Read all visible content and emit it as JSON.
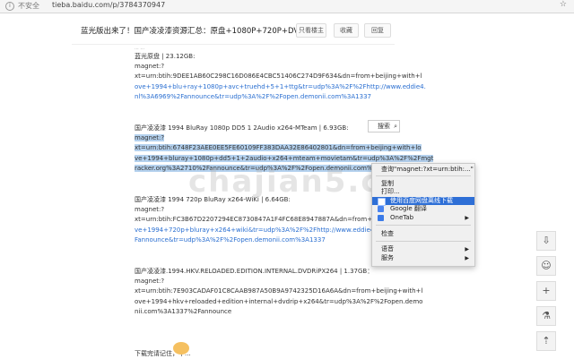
{
  "address": {
    "secure_label": "不安全",
    "url": "tieba.baidu.com/p/3784370947"
  },
  "header": {
    "title": "蓝光版出来了！国产凌凌漆资源汇总：原盘+1080P+720P+DVD...",
    "btn_owner": "只看楼主",
    "btn_fav": "收藏",
    "btn_reply": "回复"
  },
  "post": {
    "lines_a": [
      "蓝光原盘 | 23.12GB:",
      "magnet:?",
      "xt=urn:btih:9DEE1AB60C298C16D086E4CBC51406C274D9F634&dn=from+beijing+with+l",
      "ove+1994+blu+ray+1080p+avc+truehd+5+1+ttg&tr=udp%3A%2F%2Fhttp://www.eddie4.",
      "nl%3A6969%2Fannounce&tr=udp%3A%2F%2Fopen.demonii.com%3A1337"
    ],
    "lines_b_title": "国产凌凌漆 1994 BluRay 1080p DD5 1 2Audio x264-MTeam | 6.93GB:",
    "lines_b": [
      "magnet:?",
      "xt=urn:btih:6748F23AEE0EE5FE60109FF383DAA32E86402801&dn=from+beijing+with+lo",
      "ve+1994+bluray+1080p+dd5+1+2audio+x264+mteam+movietam&tr=udp%3A%2F%2Fmgt",
      "racker.org%3A2710%2Fannounce&tr=udp%3A%2F%2Fopen.demonii.com%3A1337"
    ],
    "lines_c_title": "国产凌凌漆 1994 720p BluRay x264-WiKi | 6.64GB:",
    "lines_c": [
      "magnet:?",
      "xt=urn:btih:FC3B67D2207294EC8730847A1F4FC68E8947887A&dn=from+beijing+with+lo",
      "ve+1994+720p+bluray+x264+wiki&tr=udp%3A%2F%2Fhttp://www.eddie4.nl%3A6969%2F",
      "Fannounce&tr=udp%3A%2F%2Fopen.demonii.com%3A1337"
    ],
    "lines_d_title": "国产凌凌漆.1994.HKV.RELOADED.EDITION.INTERNAL.DVDRiPX264 | 1.37GB：",
    "lines_d": [
      "magnet:?",
      "xt=urn:btih:7E903CADAF01C8CAAB987A50B9A9742325D16A6A&dn=from+beijing+with+l",
      "ove+1994+hkv+reloaded+edition+internal+dvdrip+x264&tr=udp%3A%2F%2Fopen.demo",
      "nii.com%3A1337%2Fannounce"
    ],
    "footer_text": "下载完请记住，下..."
  },
  "search_button": {
    "label": "搜索"
  },
  "context_menu": {
    "items": [
      {
        "label": "查询\"magnet:?xt=urn:btih:...\""
      },
      {
        "label": "复制"
      },
      {
        "label": "打印..."
      },
      {
        "label": "使用百度网盘离线下载"
      },
      {
        "label": "Google 翻译"
      },
      {
        "label": "OneTab"
      },
      {
        "label": "检查"
      },
      {
        "label": "语音"
      },
      {
        "label": "服务"
      }
    ]
  },
  "watermark": "chajian5.com",
  "colors": {
    "selection": "#b4d1ee",
    "menu_highlight": "#2e6fd6",
    "link": "#2a6fd1"
  }
}
